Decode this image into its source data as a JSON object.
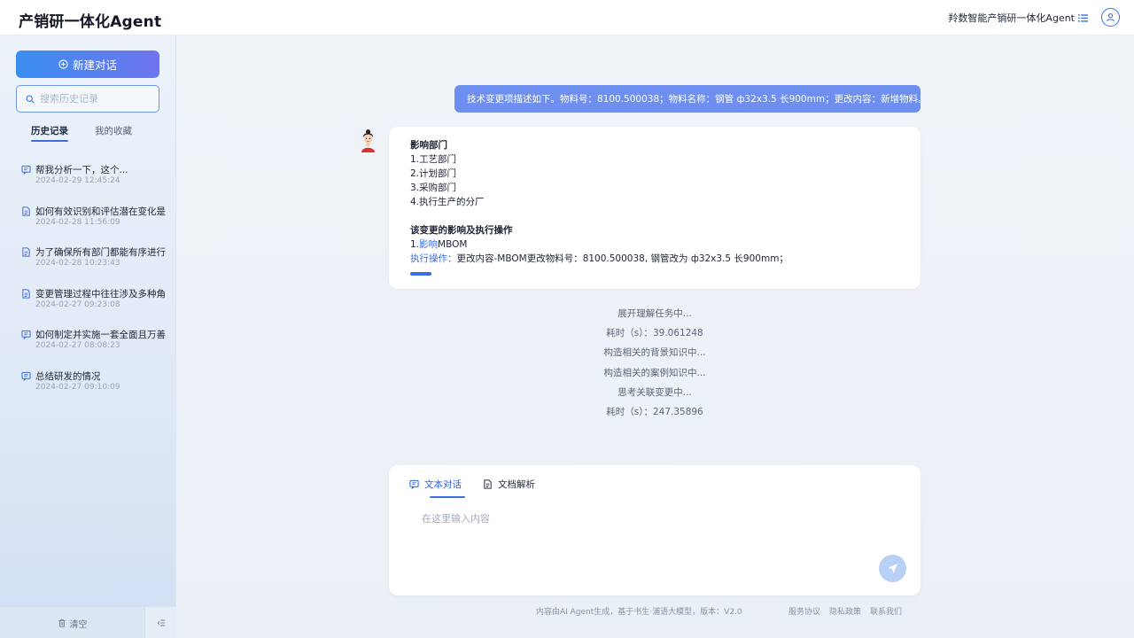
{
  "header": {
    "app_title": "产销研一体化Agent",
    "brand": "羚数智能产销研一体化Agent"
  },
  "sidebar": {
    "new_chat_label": "新建对话",
    "search_placeholder": "搜索历史记录",
    "tabs": [
      {
        "label": "历史记录",
        "active": true
      },
      {
        "label": "我的收藏",
        "active": false
      }
    ],
    "history": [
      {
        "icon": "chat-icon",
        "title": "帮我分析一下，这个...",
        "date": "2024-02-29  12:45:24"
      },
      {
        "icon": "document-icon",
        "title": "如何有效识别和评估潜在变化是",
        "date": "2024-02-28  11:56:09"
      },
      {
        "icon": "document-icon",
        "title": "为了确保所有部门都能有序进行",
        "date": "2024-02-28  10:23:43"
      },
      {
        "icon": "document-icon",
        "title": "变更管理过程中往往涉及多种角",
        "date": "2024-02-27  09:23:08"
      },
      {
        "icon": "chat-icon",
        "title": "如何制定并实施一套全面且万善",
        "date": "2024-02-27  08:08:23"
      },
      {
        "icon": "chat-icon",
        "title": "总结研发的情况",
        "date": "2024-02-27  09:10:09"
      }
    ],
    "clear_label": "清空"
  },
  "conversation": {
    "user_message": "技术变更项描述如下。物料号：8100.500038；物料名称：钢管 ф32x3.5 长900mm；更改内容：新增物料。",
    "answer": {
      "section1_title": "影响部门",
      "departments": [
        "1.工艺部门",
        "2.计划部门",
        "3.采购部门",
        "4.执行生产的分厂"
      ],
      "section2_title": "该变更的影响及执行操作",
      "impact_prefix": "1.",
      "impact_link": "影响",
      "impact_target": "MBOM",
      "action_label": "执行操作：",
      "action_text": "更改内容-MBOM更改物料号：8100.500038, 钢管改为 ф32x3.5 长900mm；"
    },
    "status_lines": [
      "展开理解任务中...",
      "耗时（s）：39.061248",
      "构造相关的背景知识中...",
      "构造相关的案例知识中...",
      "思考关联变更中...",
      "耗时（s）：247.35896"
    ]
  },
  "composer": {
    "tabs": [
      {
        "label": "文本对话",
        "icon": "chat-icon",
        "active": true
      },
      {
        "label": "文档解析",
        "icon": "document-icon",
        "active": false
      }
    ],
    "placeholder": "在这里输入内容"
  },
  "footer": {
    "note": "内容由AI Agent生成，基于书生·浦语大模型，版本：V2.0",
    "links": [
      "服务协议",
      "隐私政策",
      "联系我们"
    ]
  },
  "colors": {
    "accent": "#3c6fe3",
    "user_bubble": "#6e8ff0",
    "new_chat_gradient_start": "#3a8ef0",
    "new_chat_gradient_end": "#6f74ef",
    "send_button": "#b8d0f6"
  }
}
